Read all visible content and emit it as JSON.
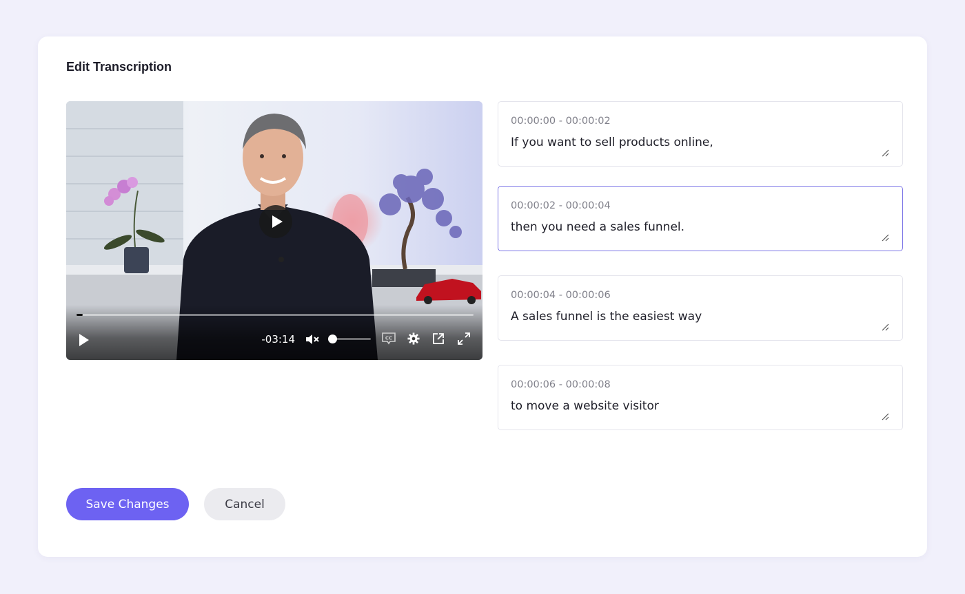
{
  "dialog": {
    "title": "Edit Transcription"
  },
  "video": {
    "remaining_time": "-03:14",
    "progress_fraction": 0.015,
    "volume_fraction": 0.0,
    "muted": true,
    "icons": {
      "big_play": "play-icon",
      "play": "play-icon",
      "mute": "volume-muted-icon",
      "captions": "closed-captions-icon",
      "settings": "gear-icon",
      "popout": "external-link-icon",
      "fullscreen": "fullscreen-icon"
    }
  },
  "segments": [
    {
      "time": "00:00:00 - 00:00:02",
      "text": "If you want to sell products online,"
    },
    {
      "time": "00:00:02 - 00:00:04",
      "text": "then you need a sales funnel."
    },
    {
      "time": "00:00:04 - 00:00:06",
      "text": "A sales funnel is the easiest way"
    },
    {
      "time": "00:00:06 - 00:00:08",
      "text": "to move a website visitor"
    }
  ],
  "active_segment": 1,
  "actions": {
    "save_label": "Save Changes",
    "cancel_label": "Cancel"
  },
  "colors": {
    "page_bg": "#f1f0fb",
    "accent": "#6d62f2",
    "active_border": "#7b74e6",
    "cancel_bg": "#ebebef"
  }
}
